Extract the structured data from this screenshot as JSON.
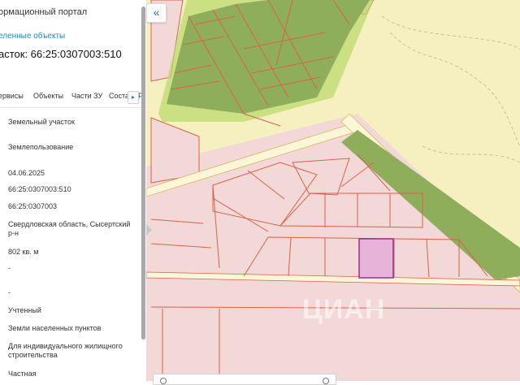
{
  "panel": {
    "portal_title": "ормационный портал",
    "selected_link": "еленные объекты",
    "parcel_title": "асток: 66:25:0307003:510",
    "tabs": [
      "ервисы",
      "Объекты",
      "Части ЗУ",
      "Соста",
      "Р"
    ],
    "more_icon": "triangle-right-icon",
    "fields": [
      "Земельный участок",
      "Землепользование",
      "04.06.2025",
      "66:25:0307003:510",
      "66:25:0307003",
      "Свердловская область, Сысертский р-н",
      "802 кв. м",
      "-",
      "-",
      "Учтенный",
      "Земли населенных пунктов",
      "Для индивидуального жилищного строительства",
      "Частная"
    ]
  },
  "map": {
    "collapse_icon": "double-chevron-left-icon",
    "handle_icon": "triangle-right-icon",
    "watermark": "ЦИАН",
    "colors": {
      "background": "#f6f0c0",
      "settlement": "#f3d8d8",
      "parcel_border": "#d9624a",
      "green_zone": "#8fae5c",
      "green_light": "#b9d86a",
      "road": "#fbf6d8",
      "selected_fill": "#e6b4d8",
      "selected_border": "#9a2e8e"
    }
  }
}
